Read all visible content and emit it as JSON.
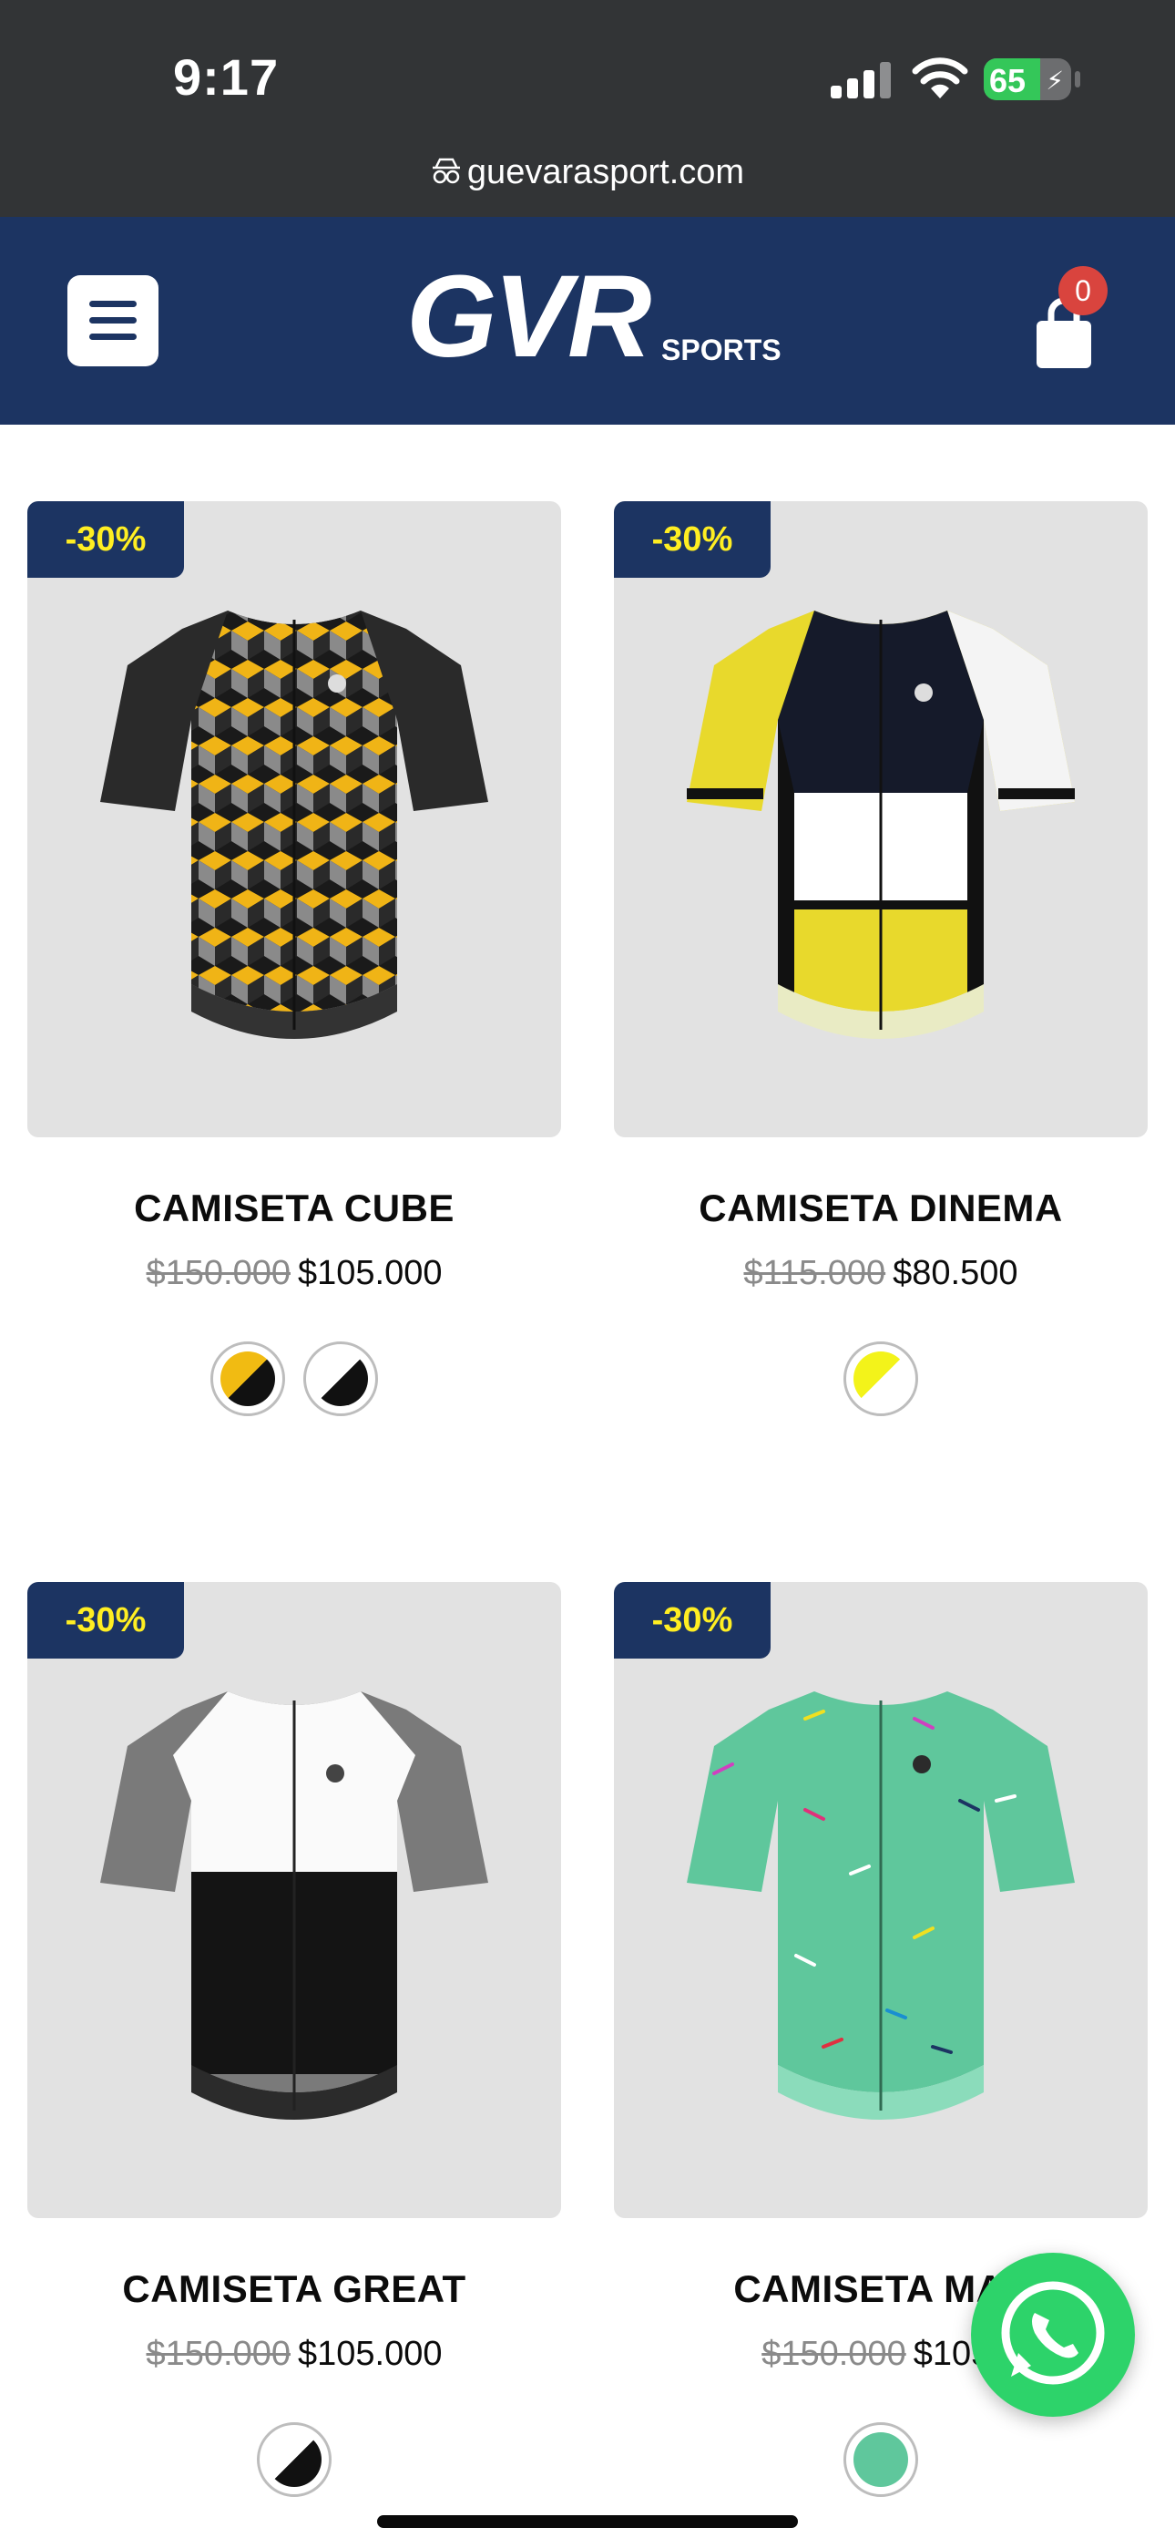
{
  "status_bar": {
    "time": "9:17",
    "battery": "65",
    "battery_level": 0.65
  },
  "browser": {
    "url": "guevarasport.com"
  },
  "header": {
    "logo_main": "GVR",
    "logo_sub": "SPORTS",
    "cart_count": "0"
  },
  "colors": {
    "header_bg": "#1c3462",
    "badge_text": "#ffee22",
    "whatsapp": "#2dd36a",
    "cart_badge": "#d9443e"
  },
  "products": [
    {
      "name": "CAMISETA CUBE",
      "discount": "-30%",
      "old_price": "$150.000",
      "new_price": "$105.000",
      "swatches": [
        [
          "#f1bb12",
          "#111111"
        ],
        [
          "#ffffff",
          "#111111"
        ]
      ]
    },
    {
      "name": "CAMISETA DINEMA",
      "discount": "-30%",
      "old_price": "$115.000",
      "new_price": "$80.500",
      "swatches": [
        [
          "#f3f31a",
          "#ffffff"
        ]
      ]
    },
    {
      "name": "CAMISETA GREAT",
      "discount": "-30%",
      "old_price": "$150.000",
      "new_price": "$105.000",
      "swatches": [
        [
          "#ffffff",
          "#111111"
        ]
      ]
    },
    {
      "name": "CAMISETA MAL",
      "discount": "-30%",
      "old_price": "$150.000",
      "new_price": "$105.",
      "swatches": [
        [
          "#5fc79c",
          "#5fc79c"
        ]
      ]
    }
  ],
  "icons": {
    "menu": "hamburger-icon",
    "cart": "shopping-bag-icon",
    "whatsapp": "whatsapp-icon",
    "privacy": "privacy-glasses-icon"
  }
}
